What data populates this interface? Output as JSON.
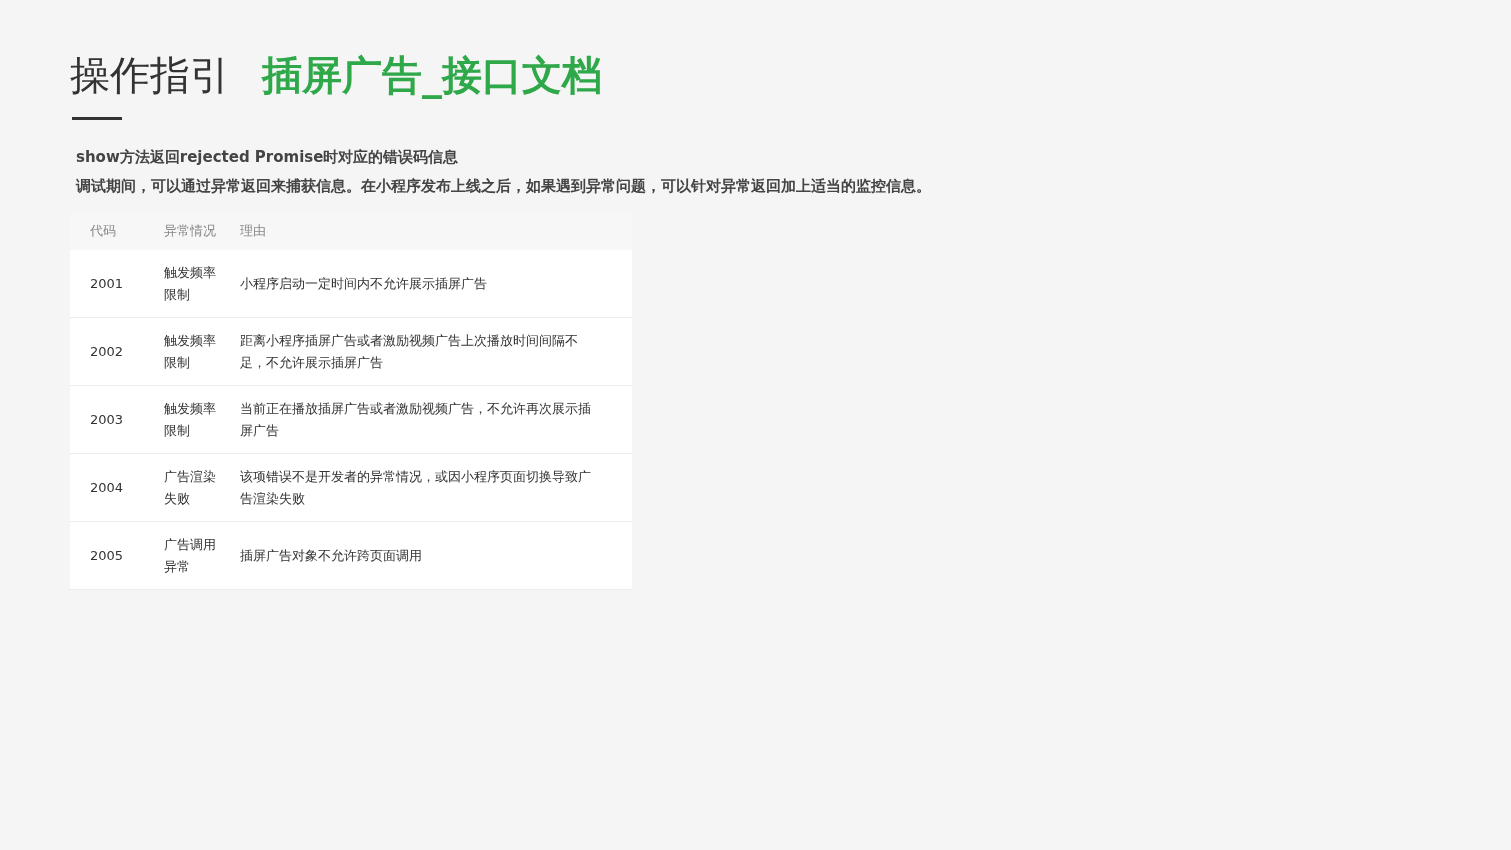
{
  "title": {
    "section": "操作指引",
    "topic": "插屏广告_接口文档"
  },
  "intro": [
    "show方法返回rejected Promise时对应的错误码信息",
    "调试期间，可以通过异常返回来捕获信息。在小程序发布上线之后，如果遇到异常问题，可以针对异常返回加上适当的监控信息。"
  ],
  "table": {
    "columns": [
      "代码",
      "异常情况",
      "理由"
    ],
    "rows": [
      {
        "code": "2001",
        "situation": "触发频率限制",
        "reason": "小程序启动一定时间内不允许展示插屏广告"
      },
      {
        "code": "2002",
        "situation": "触发频率限制",
        "reason": "距离小程序插屏广告或者激励视频广告上次播放时间间隔不足，不允许展示插屏广告"
      },
      {
        "code": "2003",
        "situation": "触发频率限制",
        "reason": "当前正在播放插屏广告或者激励视频广告，不允许再次展示插屏广告"
      },
      {
        "code": "2004",
        "situation": "广告渲染失败",
        "reason": "该项错误不是开发者的异常情况，或因小程序页面切换导致广告渲染失败"
      },
      {
        "code": "2005",
        "situation": "广告调用异常",
        "reason": "插屏广告对象不允许跨页面调用"
      }
    ]
  }
}
